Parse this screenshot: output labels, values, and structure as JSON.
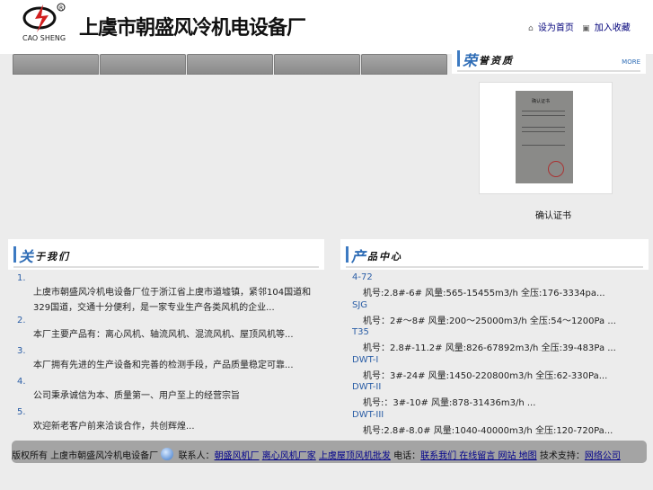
{
  "header": {
    "logo_cn": "上虞市朝盛风冷机电设备厂",
    "logo_en": "CAO SHENG",
    "links": [
      "设为首页",
      "加入收藏"
    ]
  },
  "honor": {
    "title_big": "荣",
    "title_rest": "誉资质",
    "more": "MORE",
    "cert_title": "确认证书",
    "cert_caption": "确认证书"
  },
  "about": {
    "title_big": "关",
    "title_rest": "于我们",
    "items": [
      {
        "num": "1.",
        "text": "上虞市朝盛风冷机电设备厂位于浙江省上虞市道墟镇，紧邻104国道和329国道，交通十分便利，是一家专业生产各类风机的企业..."
      },
      {
        "num": "2.",
        "text": "本厂主要产品有：离心风机、轴流风机、混流风机、屋顶风机等..."
      },
      {
        "num": "3.",
        "text": "本厂拥有先进的生产设备和完善的检测手段，产品质量稳定可靠..."
      },
      {
        "num": "4.",
        "text": "公司秉承诚信为本、质量第一、用户至上的经营宗旨"
      },
      {
        "num": "5.",
        "text": "欢迎新老客户前来洽谈合作，共创辉煌..."
      }
    ]
  },
  "products": {
    "title_big": "产",
    "title_rest": "品中心",
    "items": [
      {
        "name": "4-72",
        "spec": "机号:2.8#-6# 风量:565-15455m3/h 全压:176-3334pa..."
      },
      {
        "name": "SJG",
        "spec": "机号：2#～8# 风量:200～25000m3/h 全压:54～1200Pa ..."
      },
      {
        "name": "T35",
        "spec": "机号：2.8#-11.2# 风量:826-67892m3/h 全压:39-483Pa ..."
      },
      {
        "name": "DWT-I",
        "spec": "机号：3#-24# 风量:1450-220800m3/h 全压:62-330Pa..."
      },
      {
        "name": "DWT-II",
        "spec": "机号:：3#-10# 风量:878-31436m3/h ..."
      },
      {
        "name": "DWT-III",
        "spec": "机号:2.8#-8.0# 风量:1040-40000m3/h 全压:120-720Pa..."
      }
    ]
  },
  "footer": {
    "prefix": "版权所有 上虞市朝盛风冷机电设备厂",
    "t1": "联系人：",
    "l1": "朝盛风机厂",
    "l2": "离心风机厂家",
    "l3": "上虞屋顶风机批发",
    "t2": "电话：",
    "l4": "联系我们 在线留言 网站 地图",
    "t3": "技术支持：",
    "l5": "网络公司"
  }
}
